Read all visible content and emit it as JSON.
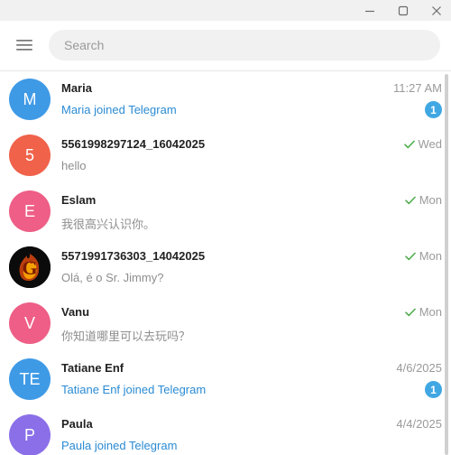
{
  "search": {
    "placeholder": "Search"
  },
  "colors": {
    "accent": "#40a7e3",
    "link": "#2a8bd4",
    "read_check": "#4fae4e"
  },
  "chats": [
    {
      "name": "Maria",
      "avatar_letter": "M",
      "avatar_color": "#3f9ae6",
      "time": "11:27 AM",
      "read": false,
      "message": "Maria joined Telegram",
      "message_style": "service",
      "unread": "1"
    },
    {
      "name": "5561998297124_16042025",
      "avatar_letter": "5",
      "avatar_color": "#f0624a",
      "time": "Wed",
      "read": true,
      "message": "hello",
      "message_style": "normal",
      "unread": ""
    },
    {
      "name": "Eslam",
      "avatar_letter": "E",
      "avatar_color": "#ee5e86",
      "time": "Mon",
      "read": true,
      "message": "我很高兴认识你。",
      "message_style": "normal",
      "unread": ""
    },
    {
      "name": "5571991736303_14042025",
      "avatar_letter": "G",
      "avatar_color": "#0b0b0b",
      "avatar_icon": "fire-letter-g-image",
      "time": "Mon",
      "read": true,
      "message": "Olá, é o Sr. Jimmy?",
      "message_style": "normal",
      "unread": ""
    },
    {
      "name": "Vanu",
      "avatar_letter": "V",
      "avatar_color": "#ee5e86",
      "time": "Mon",
      "read": true,
      "message": "你知道哪里可以去玩吗？",
      "message_style": "normal",
      "unread": ""
    },
    {
      "name": "Tatiane Enf",
      "avatar_letter": "TE",
      "avatar_color": "#3f9ae6",
      "time": "4/6/2025",
      "read": false,
      "message": "Tatiane Enf joined Telegram",
      "message_style": "service",
      "unread": "1"
    },
    {
      "name": "Paula",
      "avatar_letter": "P",
      "avatar_color": "#8a6fe8",
      "time": "4/4/2025",
      "read": false,
      "message": "Paula joined Telegram",
      "message_style": "service",
      "unread": ""
    }
  ]
}
